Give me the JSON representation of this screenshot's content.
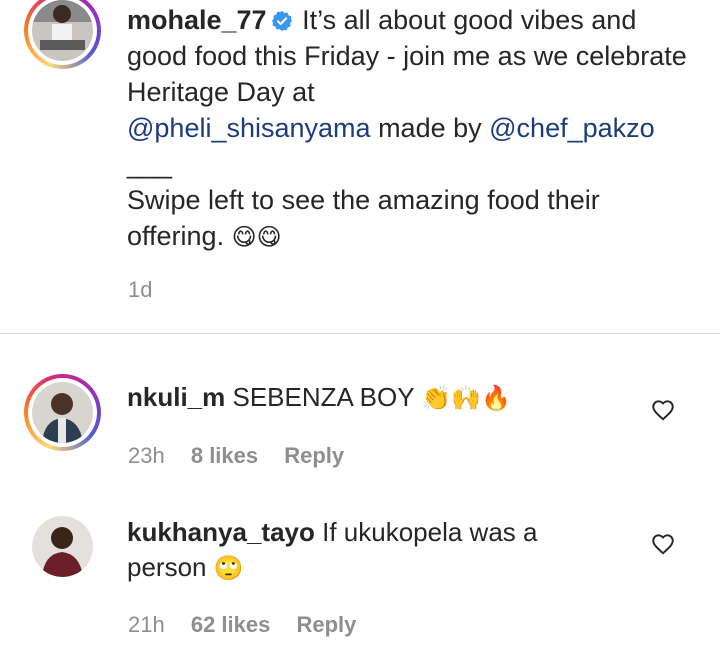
{
  "caption": {
    "username": "mohale_77",
    "text_1": "It’s all about good vibes and good food this Friday - join me as we celebrate Heritage Day at",
    "mention_1": "@pheli_shisanyama",
    "text_2": "made by",
    "mention_2": "@chef_pakzo",
    "separator": "___",
    "text_3": "Swipe left to see the amazing food their offering.",
    "emojis": "😋😋",
    "timestamp": "1d"
  },
  "comments": [
    {
      "username": "nkuli_m",
      "text": "SEBENZA BOY",
      "emojis": "👏🙌🔥",
      "time": "23h",
      "likes": "8 likes",
      "reply": "Reply"
    },
    {
      "username": "kukhanya_tayo",
      "text": "If ukukopela was a person",
      "emojis": "🙄",
      "time": "21h",
      "likes": "62 likes",
      "reply": "Reply"
    }
  ],
  "colors": {
    "text": "#262626",
    "secondary": "#8e8e8e",
    "mention": "#1c3c7c",
    "verified": "#3897f0"
  }
}
